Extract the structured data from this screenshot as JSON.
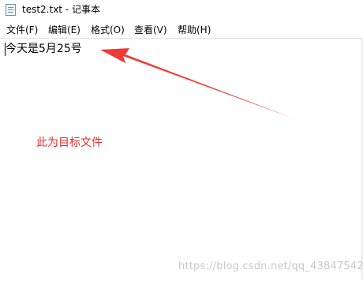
{
  "window": {
    "title": "test2.txt - 记事本",
    "icon": "notepad-icon"
  },
  "menu": [
    {
      "label": "文件(F)"
    },
    {
      "label": "编辑(E)"
    },
    {
      "label": "格式(O)"
    },
    {
      "label": "查看(V)"
    },
    {
      "label": "帮助(H)"
    }
  ],
  "document": {
    "content": "今天是5月25号"
  },
  "annotation": {
    "text": "此为目标文件",
    "color": "#e0312e"
  },
  "watermark": "https://blog.csdn.net/qq_43847542"
}
